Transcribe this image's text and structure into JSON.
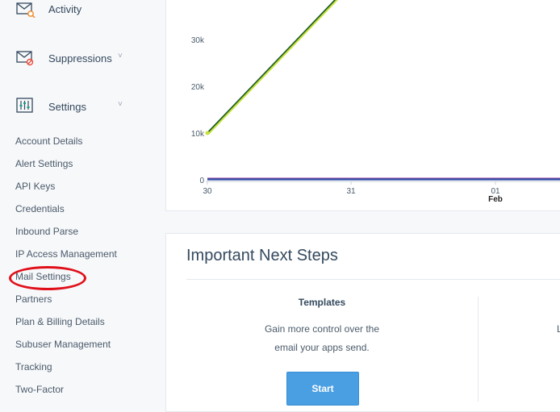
{
  "sidebar": {
    "main_items": [
      {
        "label": "Activity",
        "icon": "activity-envelope-icon"
      },
      {
        "label": "Suppressions",
        "icon": "suppressions-envelope-icon"
      },
      {
        "label": "Settings",
        "icon": "settings-sliders-icon"
      }
    ],
    "chevron": "˅",
    "sub_items": [
      {
        "label": "Account Details"
      },
      {
        "label": "Alert Settings"
      },
      {
        "label": "API Keys"
      },
      {
        "label": "Credentials"
      },
      {
        "label": "Inbound Parse"
      },
      {
        "label": "IP Access Management"
      },
      {
        "label": "Mail Settings"
      },
      {
        "label": "Partners"
      },
      {
        "label": "Plan & Billing Details"
      },
      {
        "label": "Subuser Management"
      },
      {
        "label": "Tracking"
      },
      {
        "label": "Two-Factor"
      }
    ],
    "highlight_color": "#e0101a"
  },
  "chart_data": {
    "type": "line",
    "x": [
      "30",
      "31",
      "01"
    ],
    "x_sublabel": "Feb",
    "y_ticks": [
      "0",
      "10k",
      "20k",
      "30k"
    ],
    "ylim": [
      0,
      40000
    ],
    "series": [
      {
        "color": "#1e5b2a",
        "values": [
          10000,
          42000
        ]
      },
      {
        "color": "#c6e23a",
        "values": [
          10000,
          42000
        ]
      },
      {
        "color": "#8e3a9e",
        "values": [
          250,
          250,
          250,
          250
        ]
      },
      {
        "color": "#2e4fa8",
        "values": [
          80,
          80,
          80,
          80
        ]
      }
    ]
  },
  "next_steps": {
    "title": "Important Next Steps",
    "templates": {
      "title": "Templates",
      "desc_line1": "Gain more control over the",
      "desc_line2": "email your apps send.",
      "button": "Start"
    },
    "cut_letter": "L"
  },
  "colors": {
    "accent": "#4a9fe3",
    "text": "#34495e"
  }
}
